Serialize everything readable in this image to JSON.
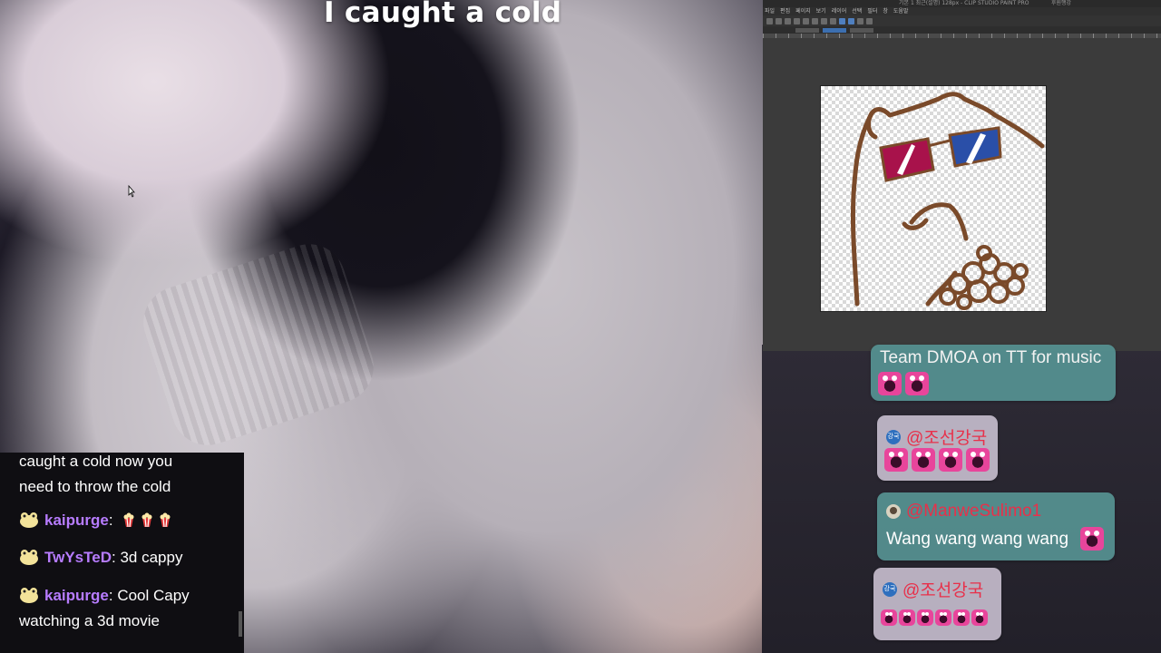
{
  "stream": {
    "title": "I caught a cold"
  },
  "drawing_app": {
    "window_title": "기본 1 최근(설명) 128px - CLIP STUDIO PAINT PRO",
    "header_right": "후원행강",
    "menu": [
      "파일",
      "편집",
      "페이지",
      "보기",
      "레이어",
      "선택",
      "필터",
      "창",
      "도움말"
    ],
    "canvas_subject": "white capybara with 3d glasses and popcorn"
  },
  "chat_left": {
    "continuation": [
      "caught a cold now you",
      "need to throw the cold"
    ],
    "messages": [
      {
        "user": "kaipurge",
        "text": "",
        "emotes": [
          "popcorn",
          "popcorn",
          "popcorn"
        ]
      },
      {
        "user": "TwYsTeD",
        "text": "3d cappy",
        "emotes": []
      },
      {
        "user": "kaipurge",
        "text": "Cool Capy",
        "text2": "watching a 3d movie",
        "emotes": []
      }
    ],
    "colors": {
      "username": "#b77cff",
      "background": "#0f0e12"
    }
  },
  "chat_right": {
    "bubbles": [
      {
        "user": "",
        "text": "Team DMOA on TT for music",
        "emote_count": 2
      },
      {
        "user": "@조선강국",
        "badge": "강국",
        "text": "",
        "emote_count": 4
      },
      {
        "user": "@ManweSulimo1",
        "badge": "",
        "text": "Wang wang wang wang",
        "emote_count": 1
      },
      {
        "user": "@조선강국",
        "badge": "강국",
        "text": "",
        "emote_count": 6
      }
    ],
    "colors": {
      "teal": "#569292",
      "lavender": "#c4bccc",
      "name": "#e8304a"
    }
  }
}
